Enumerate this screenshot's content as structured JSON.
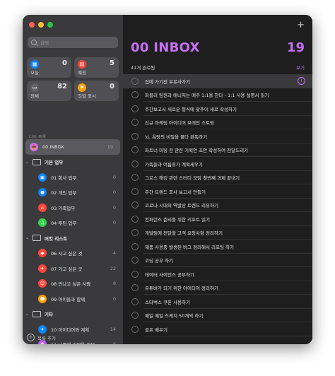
{
  "sidebar": {
    "search_placeholder": "검색",
    "tiles": [
      {
        "name": "today",
        "label": "오늘",
        "count": "0",
        "color": "#0a84ff",
        "icon": "calendar-icon",
        "glyph": "▦"
      },
      {
        "name": "scheduled",
        "label": "예정",
        "count": "5",
        "color": "#ff453a",
        "icon": "calendar-grid-icon",
        "glyph": "▤"
      },
      {
        "name": "all",
        "label": "전체",
        "count": "82",
        "color": "#636366",
        "icon": "tray-icon",
        "glyph": "▭"
      },
      {
        "name": "flagged",
        "label": "깃발 표시",
        "count": "0",
        "color": "#ff9f0a",
        "icon": "flag-icon",
        "glyph": "⚑"
      }
    ],
    "section_label": "나의 목록",
    "inbox": {
      "label": "00 INBOX",
      "count": "19",
      "color": "#c86ff5",
      "icon": "inbox-emoji-icon",
      "glyph": "📥"
    },
    "groups": [
      {
        "label": "기본 업무",
        "items": [
          {
            "label": "01 회사 업무",
            "count": "0",
            "color": "#0a84ff",
            "icon": "building-icon",
            "glyph": "▣"
          },
          {
            "label": "02 개인 업무",
            "count": "0",
            "color": "#0a84ff",
            "icon": "person-icon",
            "glyph": "●"
          },
          {
            "label": "03 가족업무",
            "count": "0",
            "color": "#ff453a",
            "icon": "house-icon",
            "glyph": "⌂"
          },
          {
            "label": "04 루틴 업무",
            "count": "0",
            "color": "#32d74b",
            "icon": "music-note-icon",
            "glyph": "♫"
          }
        ]
      },
      {
        "label": "버킷 리스트",
        "items": [
          {
            "label": "06 사고 싶은 것",
            "count": "4",
            "color": "#ff453a",
            "icon": "cart-icon",
            "glyph": "◆"
          },
          {
            "label": "07 가고 싶은 곳",
            "count": "22",
            "color": "#ff453a",
            "icon": "airplane-icon",
            "glyph": "✈"
          },
          {
            "label": "08 만나고 싶은 사람",
            "count": "8",
            "color": "#ff453a",
            "icon": "people-icon",
            "glyph": "☺"
          },
          {
            "label": "09 아이들과 함께",
            "count": "0",
            "color": "#ff9f0a",
            "icon": "child-icon",
            "glyph": "☻"
          }
        ]
      },
      {
        "label": "기타",
        "items": [
          {
            "label": "10 아이디어와 계획",
            "count": "14",
            "color": "#0a84ff",
            "icon": "lightbulb-icon",
            "glyph": "✦"
          },
          {
            "label": "11 나중에 써먹을 정보",
            "count": "6",
            "color": "#bf5af2",
            "icon": "sparkle-icon",
            "glyph": "✱"
          }
        ]
      }
    ],
    "add_list_label": "목록 추가"
  },
  "main": {
    "title": "00 INBOX",
    "count": "19",
    "accent": "#c86ff5",
    "completed_label": "41개 완료됨",
    "show_label": "보기",
    "tasks": [
      "집에 가기전 우유사가기",
      "퍼블리 팀원과 매니저는 매주 1:1을 한다 - 1:1 사용 설명서 읽기",
      "주간보고서 새로운 형식에 맞추어 새로 작성하기",
      "신규 마케팅 아이디어 브레인 스토밍",
      "뇌, 욕망의 비밀을 풀다 완독하기",
      "파트너 미팅 전 관련 기획안 초안 작성하여 전달드리기",
      "가족들과 여름휴가 계획세우기",
      "그로스 해킹 관련 스터디 모임 첫번째 과제 끝내기",
      "주간 트렌드 조사 보고서 만들기",
      "코로나 시대의 역발상 트렌드 리뷰하기",
      "컨퍼런스 준비를 위한 키포트 읽기",
      "개발팀에 전달할 고객 요청사항 정리하기",
      "제품 사용중 발생된 버그 정리해서 리포팅 하기",
      "코딩 공부 하기",
      "데이터 사이언스 공부하기",
      "유튜버가 되기 위한 아이디어 정리하기",
      "스타벅스 쿠폰 사용하기",
      "매일 매일 스케치 50개씩 하기",
      "골프 배우기"
    ]
  }
}
